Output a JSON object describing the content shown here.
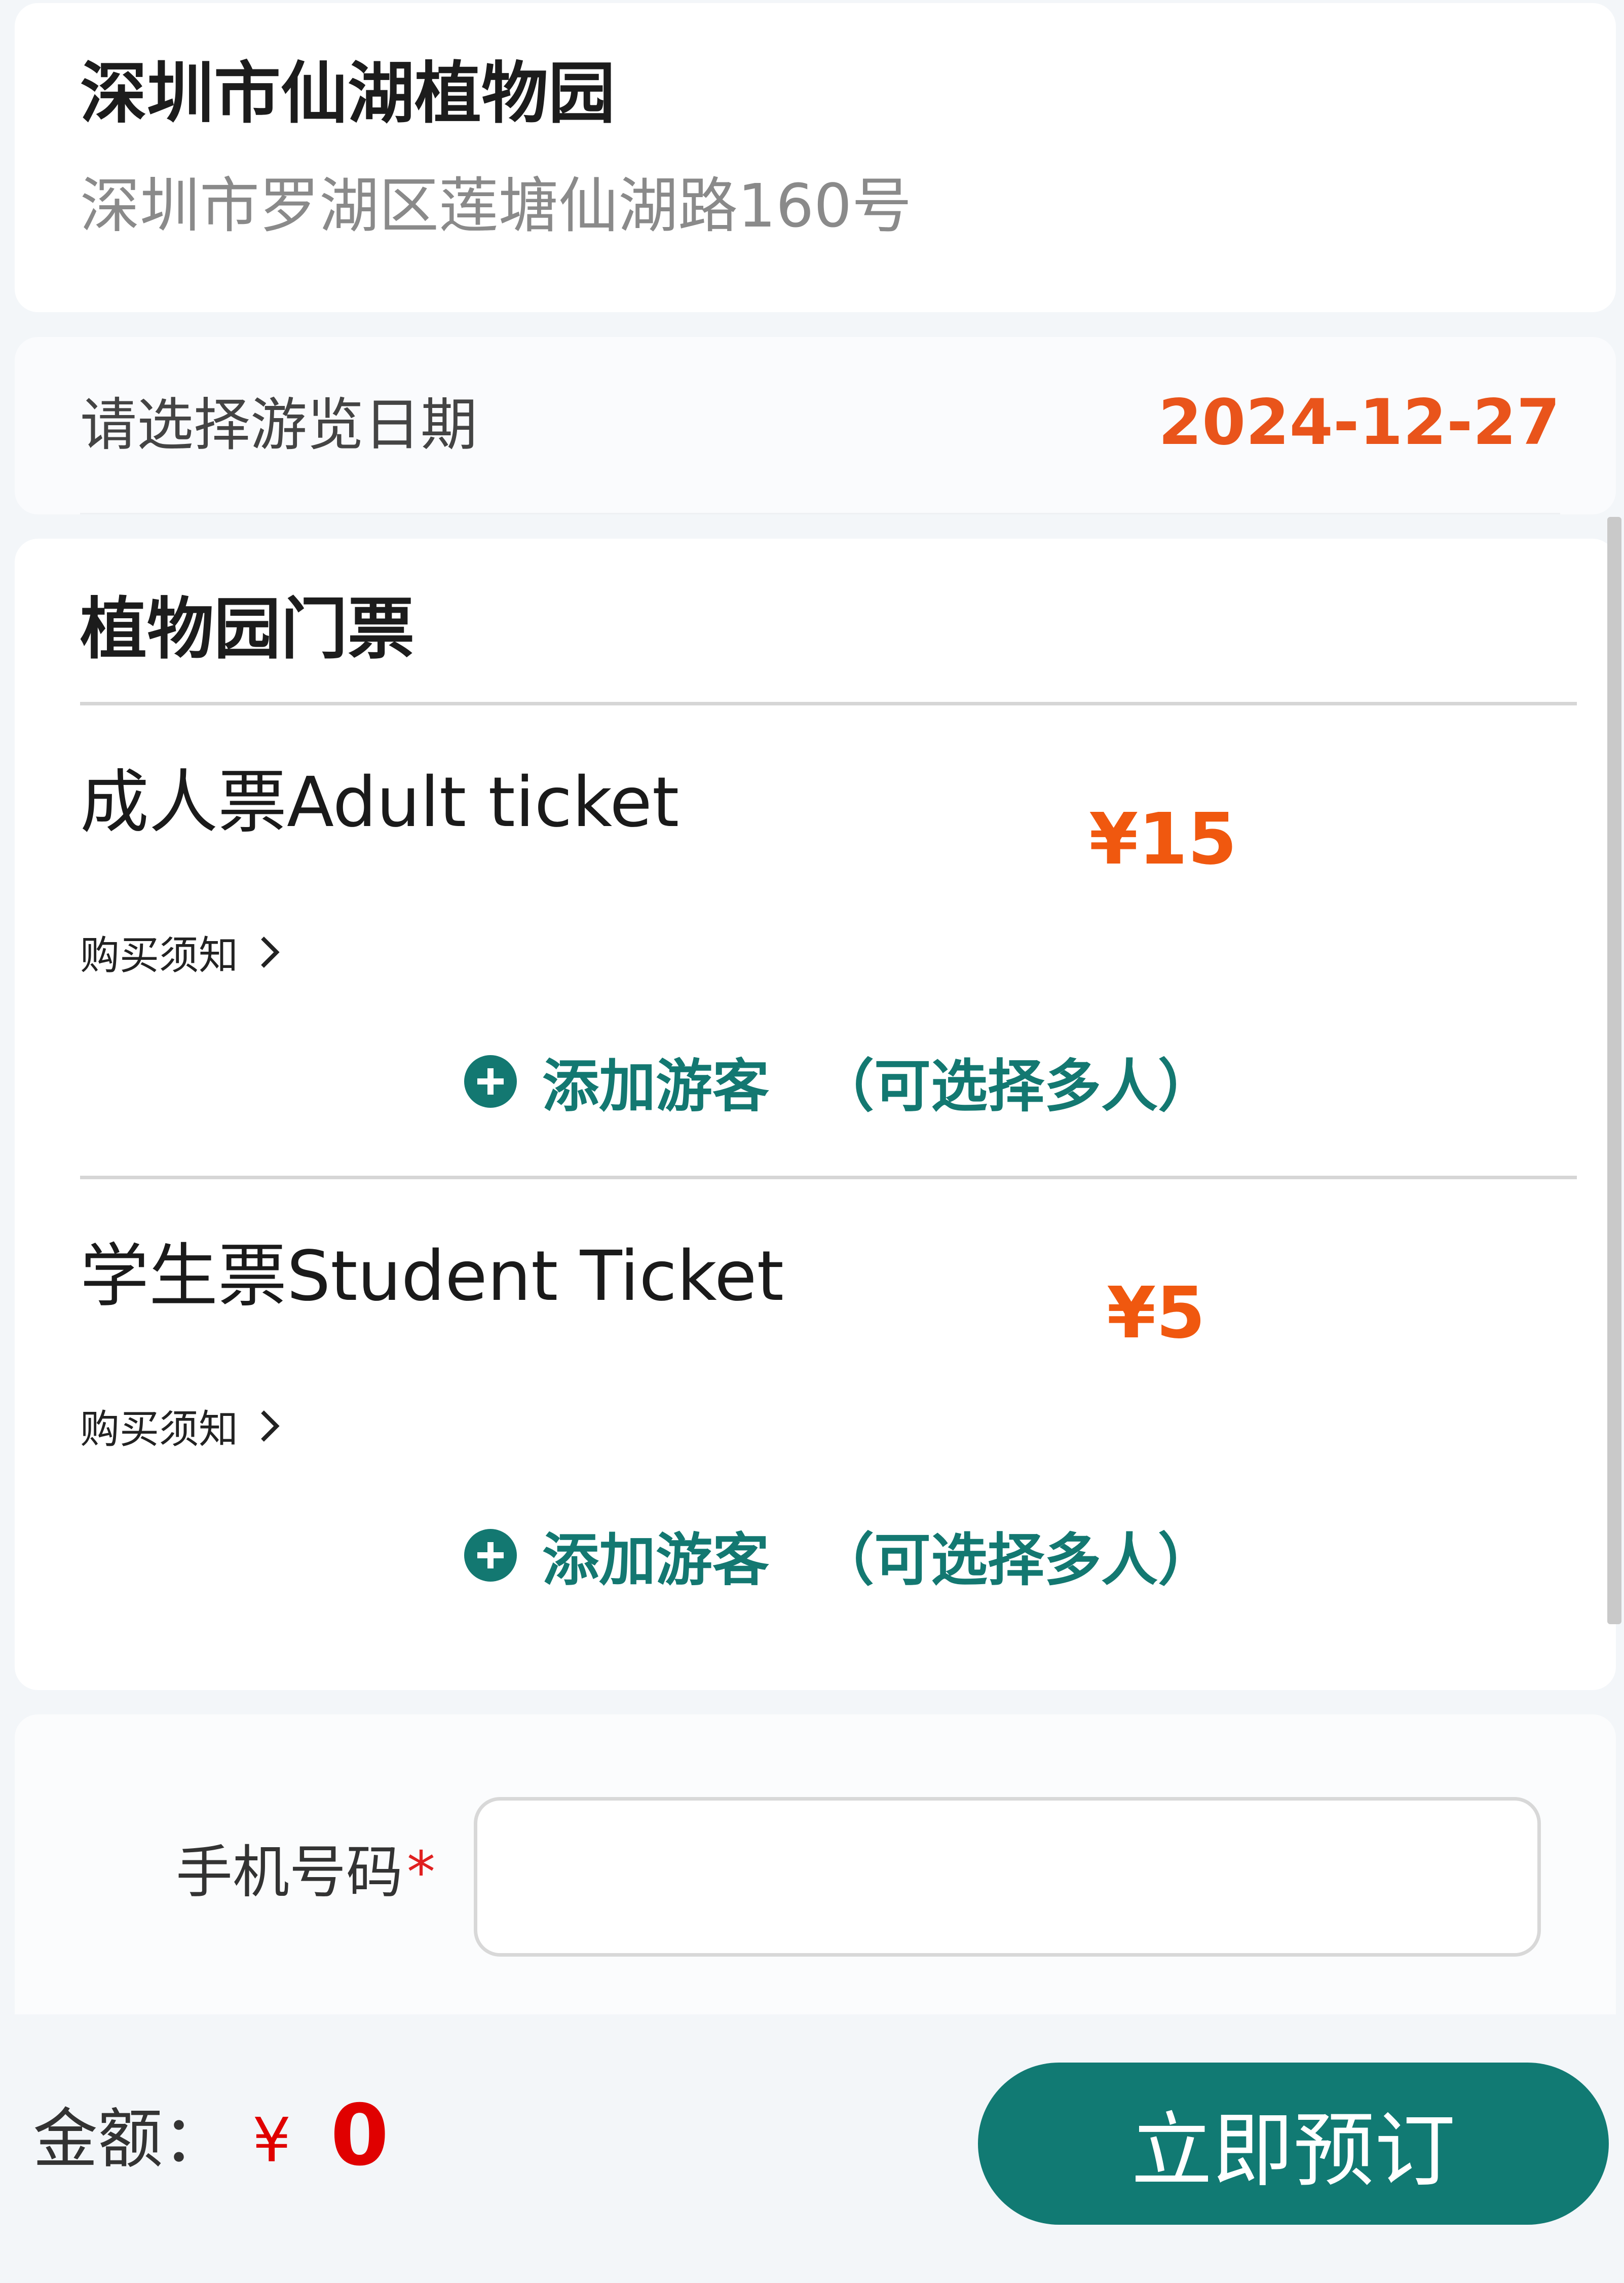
{
  "venue": {
    "name": "深圳市仙湖植物园",
    "address": "深圳市罗湖区莲塘仙湖路160号"
  },
  "visit_date": {
    "label": "请选择游览日期",
    "value": "2024-12-27"
  },
  "tickets": {
    "title": "植物园门票",
    "items": [
      {
        "name": "成人票Adult ticket",
        "price": "¥15",
        "notice_label": "购买须知",
        "add_visitor_label": "添加游客",
        "add_visitor_note": "（可选择多人）"
      },
      {
        "name": "学生票Student Ticket",
        "price": "¥5",
        "notice_label": "购买须知",
        "add_visitor_label": "添加游客",
        "add_visitor_note": "（可选择多人）"
      }
    ]
  },
  "phone": {
    "label": "手机号码",
    "required_mark": "*",
    "value": "",
    "placeholder": ""
  },
  "footer": {
    "amount_label": "金额：",
    "currency": "¥",
    "amount": "0",
    "book_button_label": "立即预订"
  },
  "colors": {
    "accent": "#117a73",
    "price": "#f0580f",
    "total": "#e00000"
  }
}
